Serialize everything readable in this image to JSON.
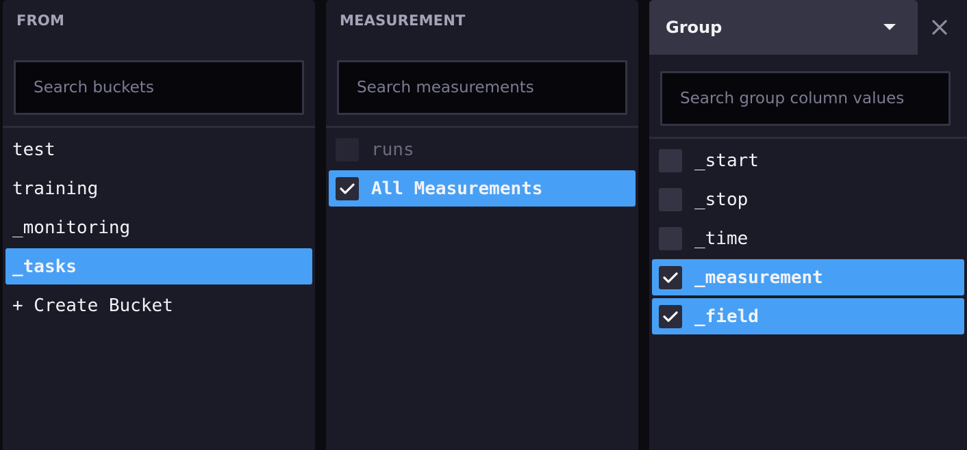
{
  "from": {
    "title": "FROM",
    "search_placeholder": "Search buckets",
    "buckets": [
      {
        "label": "test",
        "selected": false
      },
      {
        "label": "training",
        "selected": false
      },
      {
        "label": "_monitoring",
        "selected": false
      },
      {
        "label": "_tasks",
        "selected": true
      }
    ],
    "create_label": "+ Create Bucket"
  },
  "measurement": {
    "title": "MEASUREMENT",
    "search_placeholder": "Search measurements",
    "items": [
      {
        "label": "runs",
        "checked": false,
        "disabled": true
      },
      {
        "label": "All Measurements",
        "checked": true,
        "disabled": false
      }
    ]
  },
  "group": {
    "dropdown_label": "Group",
    "search_placeholder": "Search group column values",
    "columns": [
      {
        "label": "_start",
        "checked": false
      },
      {
        "label": "_stop",
        "checked": false
      },
      {
        "label": "_time",
        "checked": false
      },
      {
        "label": "_measurement",
        "checked": true
      },
      {
        "label": "_field",
        "checked": true
      }
    ]
  },
  "colors": {
    "panel_bg": "#1b1b27",
    "page_bg": "#0c0c10",
    "selected_bg": "#47a0f5",
    "checkbox_bg": "#343444",
    "text": "#f2f2f6",
    "muted_text": "#a3a4b8"
  },
  "icons": {
    "checkbox_checked": "check-icon",
    "dropdown": "caret-down-icon",
    "close": "close-icon"
  }
}
